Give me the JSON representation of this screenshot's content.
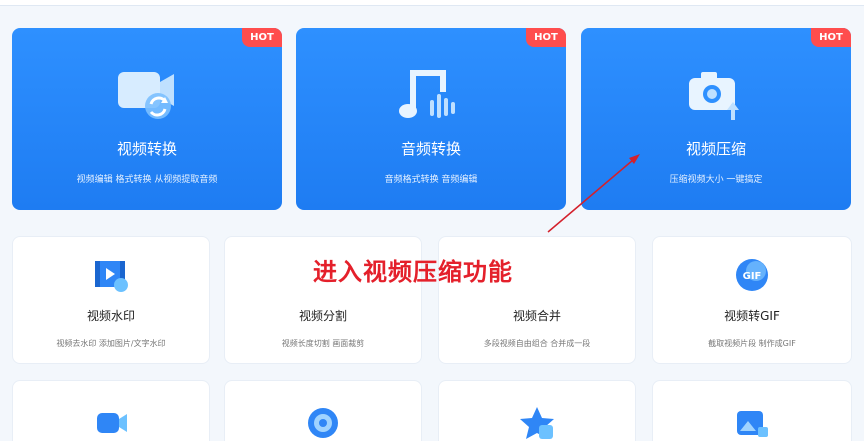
{
  "feature_cards": [
    {
      "title": "视频转换",
      "desc": "视频编辑  格式转换  从视频提取音频",
      "badge": "HOT",
      "icon": "video-convert-icon"
    },
    {
      "title": "音频转换",
      "desc": "音频格式转换  音频编辑",
      "badge": "HOT",
      "icon": "music-note-icon"
    },
    {
      "title": "视频压缩",
      "desc": "压缩视频大小  一键搞定",
      "badge": "HOT",
      "icon": "camera-compress-icon"
    }
  ],
  "tool_cards": [
    {
      "title": "视频水印",
      "desc": "视频去水印  添加图片/文字水印",
      "icon": "video-watermark-icon"
    },
    {
      "title": "视频分割",
      "desc": "视频长度切割  画面裁剪",
      "icon": "video-split-icon"
    },
    {
      "title": "视频合并",
      "desc": "多段视频自由组合  合并成一段",
      "icon": "video-merge-icon"
    },
    {
      "title": "视频转GIF",
      "desc": "截取视频片段  制作成GIF",
      "icon": "gif-icon"
    }
  ],
  "bottom_cards": [
    {
      "icon": "video-camera-icon"
    },
    {
      "icon": "disc-icon"
    },
    {
      "icon": "star-text-icon"
    },
    {
      "icon": "image-edit-icon"
    }
  ],
  "annotation": {
    "text": "进入视频压缩功能"
  },
  "colors": {
    "primary": "#1e7cf2",
    "hot_badge": "#ff4d4d",
    "annotation": "#e4202b"
  }
}
